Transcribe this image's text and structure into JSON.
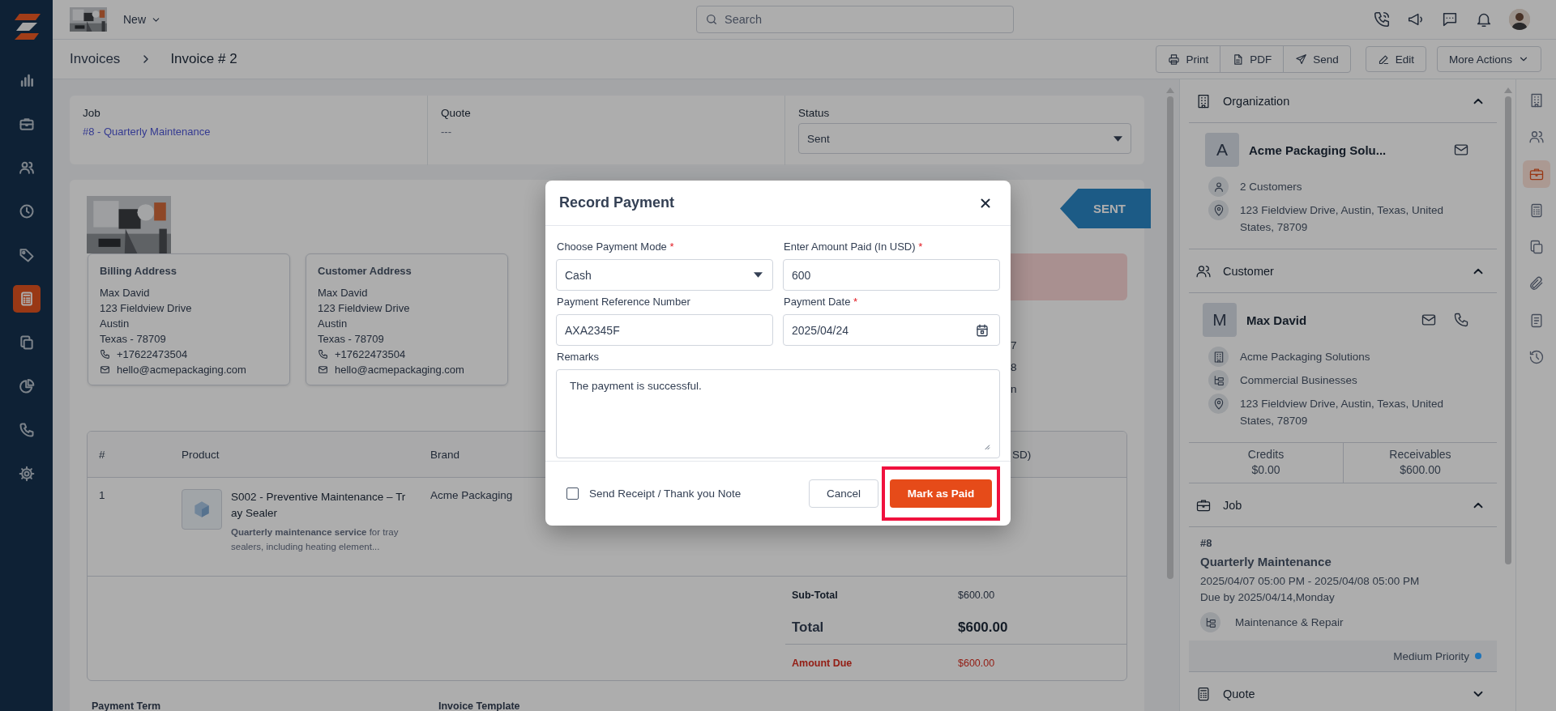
{
  "top_bar": {
    "new_menu": "New",
    "search_placeholder": "Search"
  },
  "nav": [
    {
      "selected": false
    },
    {
      "selected": false
    },
    {
      "selected": false
    },
    {
      "selected": false
    },
    {
      "selected": false
    },
    {
      "selected": true
    },
    {
      "selected": false
    },
    {
      "selected": false
    },
    {
      "selected": false
    },
    {
      "selected": false
    }
  ],
  "breadcrumb": [
    "Invoices",
    "Invoice # 2"
  ],
  "actions": {
    "group": [
      "Print",
      "PDF",
      "Send"
    ],
    "edit": "Edit",
    "more": "More Actions"
  },
  "summary": [
    {
      "label": "Job",
      "value": "#8 - Quarterly Maintenance",
      "kind": "link"
    },
    {
      "label": "Quote",
      "value": "---",
      "kind": "text"
    },
    {
      "label": "Status",
      "value": "Sent",
      "kind": "select"
    }
  ],
  "invoice": {
    "status_ribbon": "SENT",
    "addresses": [
      {
        "title": "Billing Address",
        "lines": [
          "Max David",
          "123 Fieldview Drive",
          "Austin",
          "Texas - 78709"
        ],
        "phone": "+17622473504",
        "email": "hello@acmepackaging.com"
      },
      {
        "title": "Customer Address",
        "lines": [
          "Max David",
          "123 Fieldview Drive",
          "Austin",
          "Texas - 78709"
        ],
        "phone": "+17622473504",
        "email": "hello@acmepackaging.com"
      }
    ],
    "info_fragments": [
      "7",
      "8",
      "n"
    ],
    "table": {
      "columns": [
        "#",
        "Product",
        "Brand",
        "SD)"
      ],
      "rows": [
        {
          "number": "1",
          "product": "S002 - Preventive Maintenance – Tray Sealer",
          "description": "**Quarterly maintenance service** for tray sealers, including heating element...",
          "brand": "Acme Packaging"
        }
      ]
    },
    "totals": [
      {
        "label": "Sub-Total",
        "value": "$600.00",
        "kind": "subtotal"
      },
      {
        "label": "Total",
        "value": "$600.00",
        "kind": "total"
      },
      {
        "label": "Amount Due",
        "value": "$600.00",
        "kind": "due"
      }
    ],
    "footer_labels": [
      "Payment Term",
      "Invoice Template"
    ]
  },
  "side": {
    "organization": {
      "title": "Organization",
      "expanded": true,
      "initial": "A",
      "name": "Acme Packaging Solu...",
      "details": [
        {
          "kind": "person",
          "text": "2 Customers"
        },
        {
          "kind": "address",
          "text": "123 Fieldview Drive, Austin, Texas, United States, 78709"
        }
      ]
    },
    "customer": {
      "title": "Customer",
      "expanded": true,
      "initial": "M",
      "name": "Max David",
      "details": [
        {
          "kind": "organization",
          "text": "Acme Packaging Solutions"
        },
        {
          "kind": "category",
          "text": "Commercial Businesses"
        },
        {
          "kind": "address",
          "text": "123 Fieldview Drive, Austin, Texas, United States, 78709"
        }
      ],
      "stats": [
        {
          "label": "Credits",
          "value": "$0.00"
        },
        {
          "label": "Receivables",
          "value": "$600.00"
        }
      ]
    },
    "job": {
      "title": "Job",
      "expanded": true,
      "number": "#8",
      "name": "Quarterly Maintenance",
      "schedule": "2025/04/07 05:00 PM - 2025/04/08 05:00 PM",
      "due": "Due by 2025/04/14,Monday",
      "service": "Maintenance & Repair",
      "priority": {
        "label": "Medium Priority",
        "color": "#1f74b8"
      }
    },
    "quote": {
      "title": "Quote",
      "expanded": false
    }
  },
  "rail": [
    {
      "selected": false
    },
    {
      "selected": false
    },
    {
      "selected": true
    },
    {
      "selected": false
    },
    {
      "selected": false
    },
    {
      "selected": false
    },
    {
      "selected": false
    },
    {
      "selected": false
    }
  ],
  "modal": {
    "title": "Record Payment",
    "required_mark": "*",
    "fields": [
      {
        "label": "Choose Payment Mode",
        "required": true,
        "value": "Cash",
        "kind": "select"
      },
      {
        "label": "Enter Amount Paid (In USD)",
        "required": true,
        "value": "600",
        "kind": "text"
      },
      {
        "label": "Payment Reference Number",
        "required": false,
        "value": "AXA2345F",
        "kind": "text"
      },
      {
        "label": "Payment Date",
        "required": true,
        "value": "2025/04/24",
        "kind": "date"
      }
    ],
    "remarks": {
      "label": "Remarks",
      "value": "The payment is successful."
    },
    "send_receipt": {
      "label": "Send Receipt / Thank you Note",
      "checked": false
    },
    "buttons": [
      {
        "label": "Cancel",
        "kind": "secondary",
        "highlighted": false
      },
      {
        "label": "Mark as Paid",
        "kind": "primary",
        "highlighted": true
      }
    ]
  }
}
